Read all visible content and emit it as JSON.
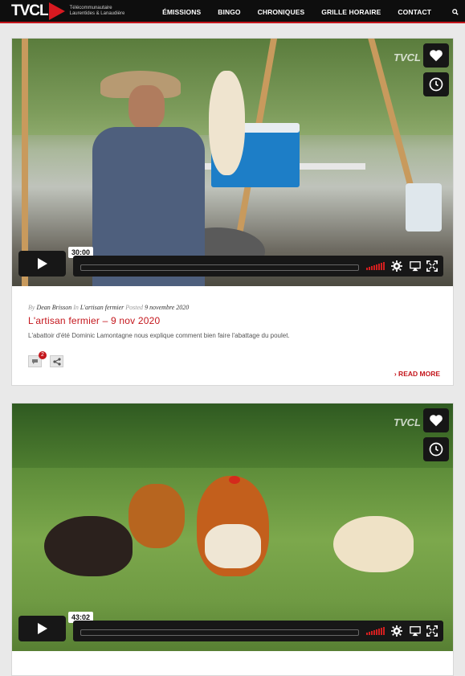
{
  "header": {
    "logo_text": "TVCL",
    "logo_tagline": "Télécommunautaire Laurentides & Lanaudière",
    "nav": [
      "ÉMISSIONS",
      "BINGO",
      "CHRONIQUES",
      "GRILLE HORAIRE",
      "CONTACT"
    ],
    "search_icon": "search-icon",
    "accent": "#c4161c"
  },
  "posts": [
    {
      "video": {
        "watermark": "TVCL",
        "duration": "30:00",
        "side_buttons": [
          "heart-icon",
          "clock-icon"
        ]
      },
      "meta": {
        "by_label": "By",
        "author": "Dean Brisson",
        "in_label": "In",
        "category": "L'artisan fermier",
        "posted_label": "Posted",
        "date": "9 novembre 2020"
      },
      "title": "L'artisan fermier – 9 nov 2020",
      "excerpt": "L'abattoir d'été Dominic Lamontagne nous explique comment bien faire l'abattage du poulet.",
      "comment_count": "2",
      "read_more": "› READ MORE"
    },
    {
      "video": {
        "watermark": "TVCL",
        "duration": "43:02",
        "side_buttons": [
          "heart-icon",
          "clock-icon"
        ]
      }
    }
  ]
}
